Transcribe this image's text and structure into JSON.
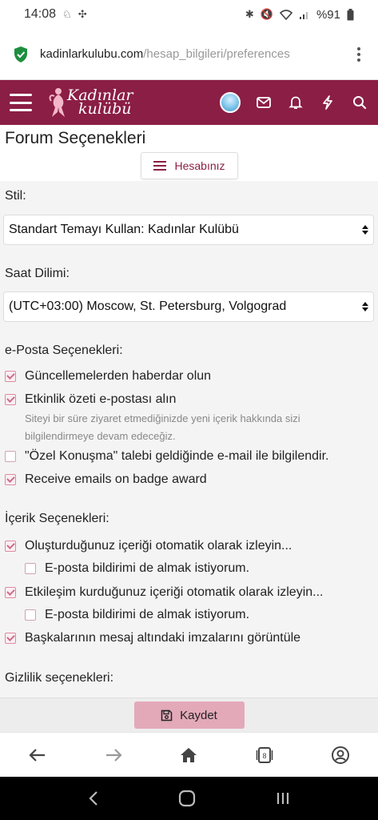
{
  "status_bar": {
    "time": "14:08",
    "battery": "%91"
  },
  "browser": {
    "url_domain": "kadinlarkulubu.com",
    "url_path": "/hesap_bilgileri/preferences"
  },
  "site": {
    "logo_line1": "Kadınlar",
    "logo_line2": "kulübü"
  },
  "page": {
    "title": "Forum Seçenekleri",
    "account_button": "Hesabınız",
    "style_label": "Stil:",
    "style_value": "Standart Temayı Kullan: Kadınlar Kulübü",
    "timezone_label": "Saat Dilimi:",
    "timezone_value": "(UTC+03:00) Moscow, St. Petersburg, Volgograd",
    "email_section": "e-Posta Seçenekleri:",
    "email_options": [
      {
        "label": "Güncellemelerden haberdar olun",
        "checked": true
      },
      {
        "label": "Etkinlik özeti e-postası alın",
        "checked": true,
        "hint": "Siteyi bir süre ziyaret etmediğinizde yeni içerik hakkında sizi bilgilendirmeye devam edeceğiz."
      },
      {
        "label": "\"Özel Konuşma\" talebi geldiğinde e-mail ile bilgilendir.",
        "checked": false
      },
      {
        "label": "Receive emails on badge award",
        "checked": true
      }
    ],
    "content_section": "İçerik Seçenekleri:",
    "content_options": [
      {
        "label": "Oluşturduğunuz içeriği otomatik olarak izleyin...",
        "checked": true
      },
      {
        "label": "E-posta bildirimi de almak istiyorum.",
        "checked": false
      },
      {
        "label": "Etkileşim kurduğunuz içeriği otomatik olarak izleyin...",
        "checked": true
      },
      {
        "label": "E-posta bildirimi de almak istiyorum.",
        "checked": false
      },
      {
        "label": "Başkalarının mesaj altındaki imzalarını görüntüle",
        "checked": true
      }
    ],
    "privacy_section": "Gizlilik seçenekleri:",
    "save_button": "Kaydet"
  },
  "colors": {
    "brand": "#8b1e44",
    "save_button": "#e3a9b9",
    "checkbox_check": "#d06b89"
  },
  "icons": [
    "shield-icon",
    "menu-icon",
    "avatar",
    "mail-icon",
    "bell-icon",
    "bolt-icon",
    "search-icon",
    "save-icon",
    "back-icon",
    "forward-icon",
    "home-icon",
    "tabs-icon",
    "profile-icon"
  ]
}
